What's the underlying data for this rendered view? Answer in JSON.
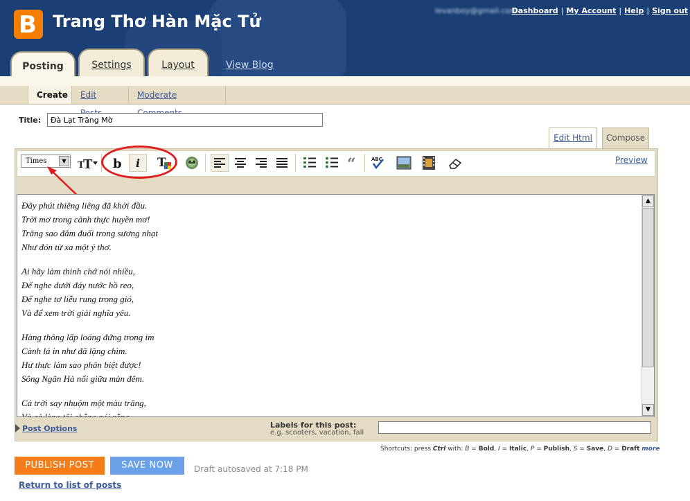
{
  "header": {
    "blog_title": "Trang Thơ Hàn Mặc Tử",
    "user_email": "levanboy@gmail.com",
    "nav": [
      "Dashboard",
      "My Account",
      "Help",
      "Sign out"
    ]
  },
  "main_tabs": [
    "Posting",
    "Settings",
    "Layout"
  ],
  "view_blog": "View Blog",
  "sub_tabs": [
    "Create",
    "Edit Posts",
    "Moderate Comments"
  ],
  "post": {
    "title_label": "Title:",
    "title_value": "Đà Lạt Trăng Mờ",
    "stanzas": [
      [
        "Đây phút thiêng liêng đã khởi đầu.",
        "Trời mơ trong cảnh thực huyền mơ!",
        "Trăng sao đắm đuối trong sương nhạt",
        "Như đón từ xa một ý thơ."
      ],
      [
        "Ai hãy làm thinh chớ nói nhiều,",
        "Để nghe dưới đáy nước hồ reo,",
        "Để nghe tơ liễu rung trong gió,",
        "Và để xem trời giải nghĩa yêu."
      ],
      [
        "Hàng thông lấp loáng đứng trong im",
        "Cành lá in như đã lặng chìm.",
        "Hư thực làm sao phân biệt được!",
        "Sông Ngân Hà nổi giữa màn đêm."
      ],
      [
        "Cả trời say nhuộm một màu trăng,",
        "Và cả lòng tôi chẳng nói rằng."
      ]
    ]
  },
  "editor_tabs": [
    "Edit Html",
    "Compose"
  ],
  "toolbar": {
    "font_value": "Times",
    "preview": "Preview",
    "icons": [
      "font-size-icon",
      "bold-icon",
      "italic-icon",
      "text-color-icon",
      "link-icon",
      "align-left-icon",
      "align-center-icon",
      "align-right-icon",
      "justify-icon",
      "numbered-list-icon",
      "bullet-list-icon",
      "blockquote-icon",
      "spellcheck-icon",
      "image-icon",
      "video-icon",
      "remove-format-icon"
    ]
  },
  "labels": {
    "post_options": "Post Options",
    "title": "Labels for this post:",
    "hint": "e.g. scooters, vacation, fall",
    "value": ""
  },
  "shortcuts": {
    "prefix": "Shortcuts: press",
    "key": "Ctrl",
    "with": "with:",
    "b": "B",
    "bold": "Bold",
    "i": "I",
    "italic": "Italic",
    "p": "P",
    "publish": "Publish",
    "s": "S",
    "save": "Save",
    "d": "D",
    "draft": "Draft",
    "more": "more"
  },
  "actions": {
    "publish": "PUBLISH POST",
    "save": "SAVE NOW",
    "autosave": "Draft autosaved at 7:18 PM",
    "return": "Return to list of posts"
  },
  "colors": {
    "header_bg": "#1a3f75",
    "publish_bg": "#f57d19",
    "save_bg": "#6aa1e8",
    "link": "#3b5b9a",
    "annotation": "#e01c1c"
  }
}
